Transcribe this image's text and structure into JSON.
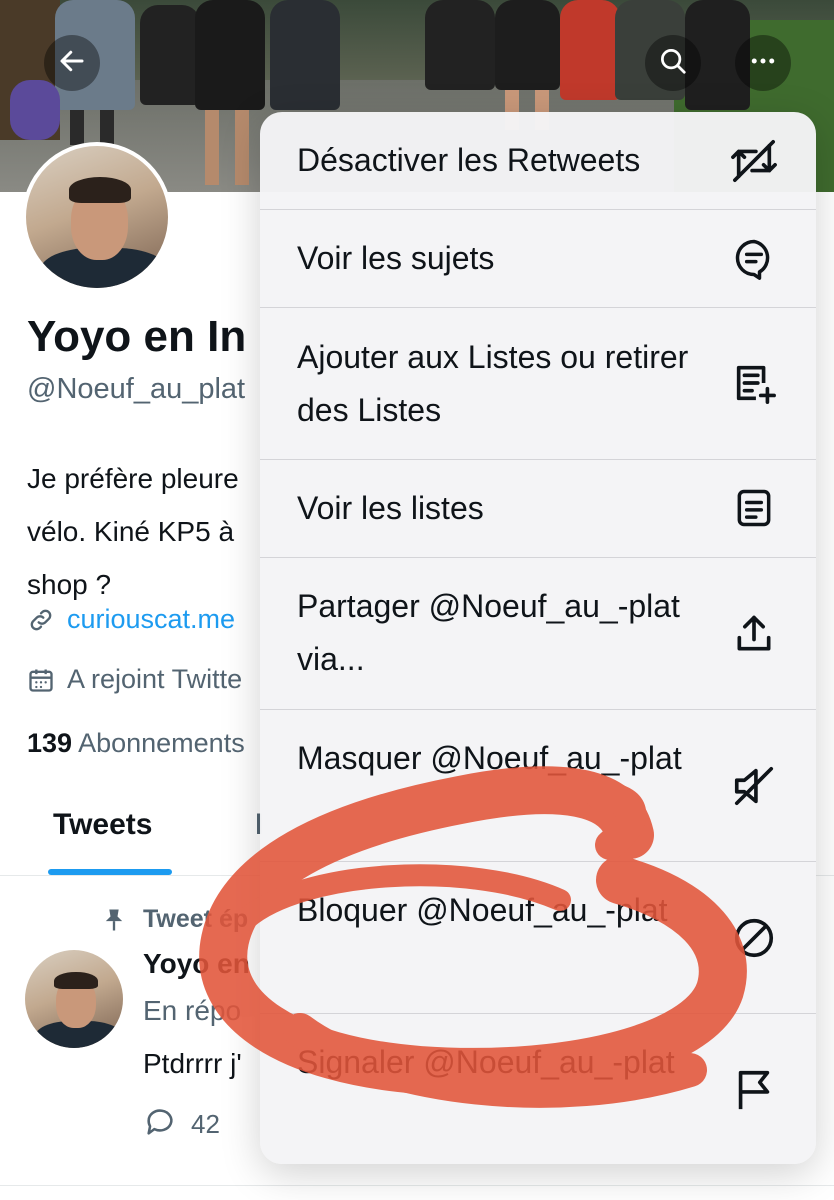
{
  "header": {
    "back_icon": "back-arrow-icon",
    "search_icon": "search-icon",
    "more_icon": "more-horizontal-icon"
  },
  "profile": {
    "name": "Yoyo en In",
    "handle": "@Noeuf_au_plat",
    "bio_lines": [
      "Je préfère pleure",
      "vélo. Kiné KP5 à",
      "shop ?"
    ],
    "link": "curiouscat.me",
    "joined": "A rejoint Twitte",
    "following_count": "139",
    "following_label": "Abonnements"
  },
  "tabs": [
    {
      "label": "Tweets",
      "active": true
    },
    {
      "label": "I",
      "active": false
    }
  ],
  "pinned_tweet": {
    "pinned_label": "Tweet ép",
    "author": "Yoyo en",
    "reply_to": "En répo",
    "text": "Ptdrrrr j'",
    "reply_count": "42"
  },
  "menu": {
    "items": [
      {
        "label": "Désactiver les Retweets",
        "icon": "retweet-off-icon"
      },
      {
        "label": "Voir les sujets",
        "icon": "topics-icon"
      },
      {
        "label": "Ajouter aux Listes ou retirer des Listes",
        "icon": "list-add-icon"
      },
      {
        "label": "Voir les listes",
        "icon": "list-icon"
      },
      {
        "label": "Partager @Noeuf_au_-plat via...",
        "icon": "share-icon"
      },
      {
        "label": "Masquer @Noeuf_au_-plat",
        "icon": "mute-icon"
      },
      {
        "label": "Bloquer @Noeuf_au_-plat",
        "icon": "block-icon"
      },
      {
        "label": "Signaler @Noeuf_au_-plat",
        "icon": "flag-icon"
      }
    ]
  },
  "colors": {
    "accent": "#1d9bf0",
    "annotation": "#e2553a",
    "secondary_text": "#536471"
  }
}
